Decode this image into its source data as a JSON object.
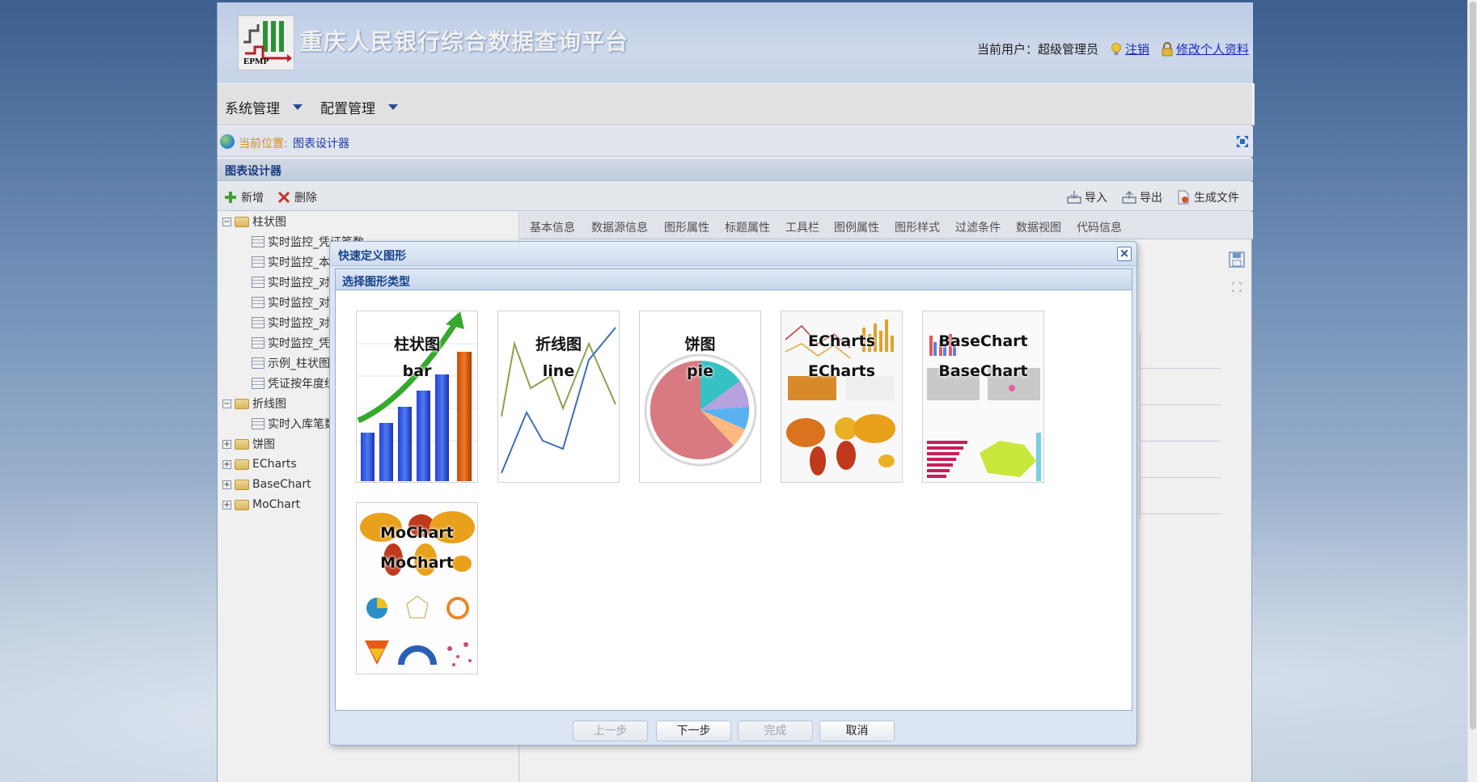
{
  "header": {
    "logo_text": "EPMP",
    "title": "重庆人民银行综合数据查询平台",
    "user_label": "当前用户：超级管理员",
    "logout_link": "注销",
    "profile_link": " 修改个人资料"
  },
  "menu": {
    "items": [
      {
        "label": "系统管理"
      },
      {
        "label": "配置管理"
      }
    ]
  },
  "location": {
    "label": "当前位置:",
    "value": "图表设计器"
  },
  "panel": {
    "title": "图表设计器"
  },
  "toolbar": {
    "add_label": "新增",
    "delete_label": "删除",
    "import_label": "导入",
    "export_label": "导出",
    "generate_label": "生成文件"
  },
  "tree": {
    "nodes": [
      {
        "label": "柱状图",
        "type": "folder",
        "expanded": true
      },
      {
        "label": "实时监控_凭证笔数",
        "type": "leaf"
      },
      {
        "label": "实时监控_本",
        "type": "leaf"
      },
      {
        "label": "实时监控_对",
        "type": "leaf"
      },
      {
        "label": "实时监控_对",
        "type": "leaf"
      },
      {
        "label": "实时监控_对",
        "type": "leaf"
      },
      {
        "label": "实时监控_凭",
        "type": "leaf"
      },
      {
        "label": "示例_柱状图",
        "type": "leaf"
      },
      {
        "label": "凭证按年度统",
        "type": "leaf"
      },
      {
        "label": "折线图",
        "type": "folder",
        "expanded": true
      },
      {
        "label": "实时入库笔数",
        "type": "leaf"
      },
      {
        "label": "饼图",
        "type": "folder",
        "expanded": false
      },
      {
        "label": "ECharts",
        "type": "folder",
        "expanded": false
      },
      {
        "label": "BaseChart",
        "type": "folder",
        "expanded": false
      },
      {
        "label": "MoChart",
        "type": "folder",
        "expanded": false
      }
    ]
  },
  "tabs": [
    {
      "label": "基本信息"
    },
    {
      "label": "数据源信息"
    },
    {
      "label": "图形属性"
    },
    {
      "label": "标题属性"
    },
    {
      "label": "工具栏"
    },
    {
      "label": "图例属性"
    },
    {
      "label": "图形样式"
    },
    {
      "label": "过滤条件"
    },
    {
      "label": "数据视图"
    },
    {
      "label": "代码信息"
    }
  ],
  "dialog": {
    "title": "快速定义图形",
    "subtitle": "选择图形类型",
    "chart_types": [
      {
        "name": "柱状图",
        "code": "bar"
      },
      {
        "name": "折线图",
        "code": "line"
      },
      {
        "name": "饼图",
        "code": "pie"
      },
      {
        "name": "ECharts",
        "code": "ECharts"
      },
      {
        "name": "BaseChart",
        "code": "BaseChart"
      },
      {
        "name": "MoChart",
        "code": "MoChart"
      }
    ],
    "buttons": {
      "prev": "上一步",
      "next": "下一步",
      "finish": "完成",
      "cancel": "取消"
    }
  },
  "colors": {
    "title_blue": "#15428b",
    "link_blue": "#1a2fd1",
    "location_orange": "#e79a1a"
  }
}
